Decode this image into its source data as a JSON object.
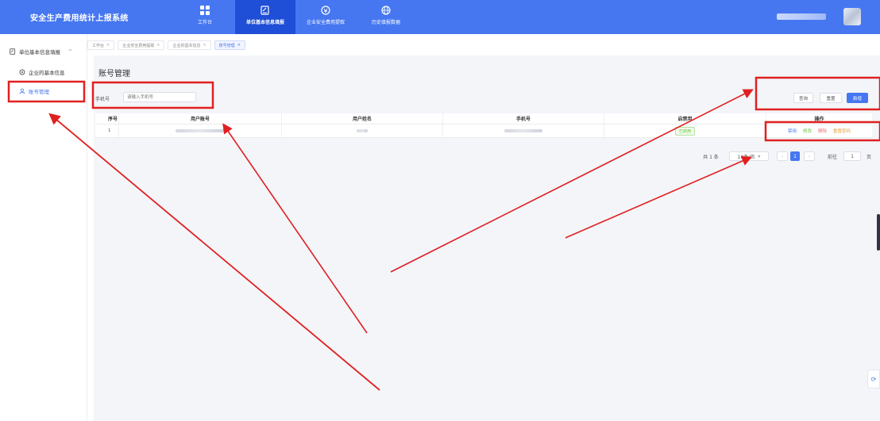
{
  "app": {
    "title": "安全生产费用统计上报系统"
  },
  "nav": [
    {
      "label": "工作台",
      "icon": "grid-icon"
    },
    {
      "label": "单位基本信息填报",
      "icon": "edit-doc-icon"
    },
    {
      "label": "企业安全费用提取",
      "icon": "money-cycle-icon"
    },
    {
      "label": "历史填报数据",
      "icon": "globe-icon"
    }
  ],
  "sidebar": {
    "group": "单位基本信息填报",
    "items": [
      {
        "label": "企业的基本信息",
        "icon": "settings-icon"
      },
      {
        "label": "账号管理",
        "icon": "user-icon"
      }
    ]
  },
  "tabs": [
    {
      "label": "工作台",
      "close": "×"
    },
    {
      "label": "企业安全费用提取",
      "close": "×"
    },
    {
      "label": "企业的基本信息",
      "close": "×"
    },
    {
      "label": "账号管理",
      "close": "×"
    }
  ],
  "page": {
    "title": "账号管理"
  },
  "search": {
    "label": "手机号",
    "placeholder": "请输入手机号"
  },
  "buttons": {
    "query": "查询",
    "reset": "重置",
    "add": "新增"
  },
  "table": {
    "headers": [
      "序号",
      "用户账号",
      "用户姓名",
      "手机号",
      "启禁用",
      "操作"
    ],
    "rows": [
      {
        "index": "1",
        "status": "已启用",
        "ops": [
          "禁用",
          "修改",
          "删除",
          "重置密码"
        ]
      }
    ]
  },
  "pagination": {
    "total": "共 1 条",
    "page_size": "10条/页",
    "current": "1",
    "goto_label": "前往",
    "goto_value": "1",
    "page_unit": "页",
    "prev": "‹",
    "next": "›"
  },
  "colors": {
    "primary": "#4677f1",
    "nav_active": "#1f4fd6",
    "annotation": "#e02020",
    "success": "#67c23a",
    "warning": "#e6a23c",
    "danger": "#f56c6c"
  }
}
